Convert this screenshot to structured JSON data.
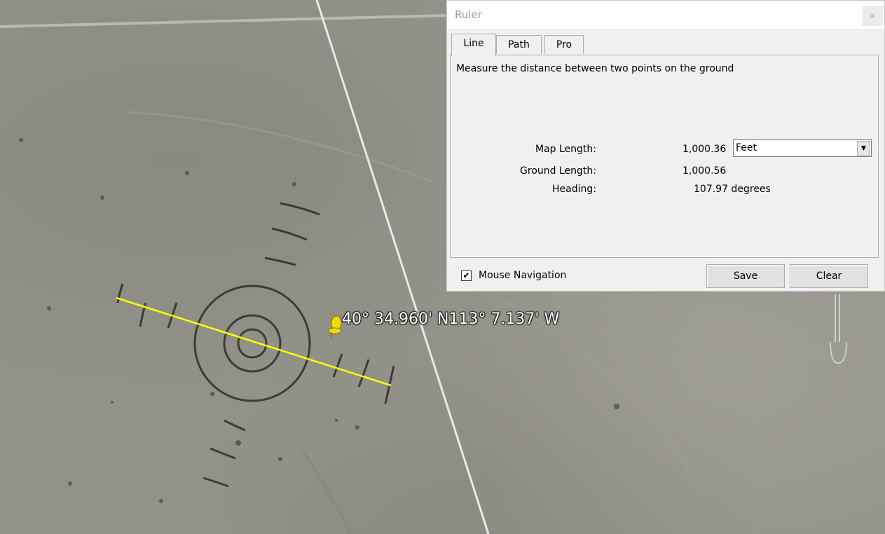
{
  "map": {
    "placemark_label": "40° 34.960' N113° 7.137' W",
    "ruler_line_color": "#ffff00",
    "placemark_color": "#f5d800",
    "placemark_icon": "pushpin-icon"
  },
  "ruler_dialog": {
    "title": "Ruler",
    "close_icon": "close-icon",
    "tabs": [
      {
        "label": "Line",
        "active": true
      },
      {
        "label": "Path",
        "active": false
      },
      {
        "label": "Pro",
        "active": false
      }
    ],
    "description": "Measure the distance between two points on the ground",
    "map_length": {
      "label": "Map Length:",
      "value": "1,000.36",
      "unit": "Feet"
    },
    "ground_length": {
      "label": "Ground Length:",
      "value": "1,000.56"
    },
    "heading": {
      "label": "Heading:",
      "value": "107.97 degrees"
    },
    "mouse_navigation": {
      "label": "Mouse Navigation",
      "checked": true
    },
    "save_label": "Save",
    "clear_label": "Clear"
  }
}
